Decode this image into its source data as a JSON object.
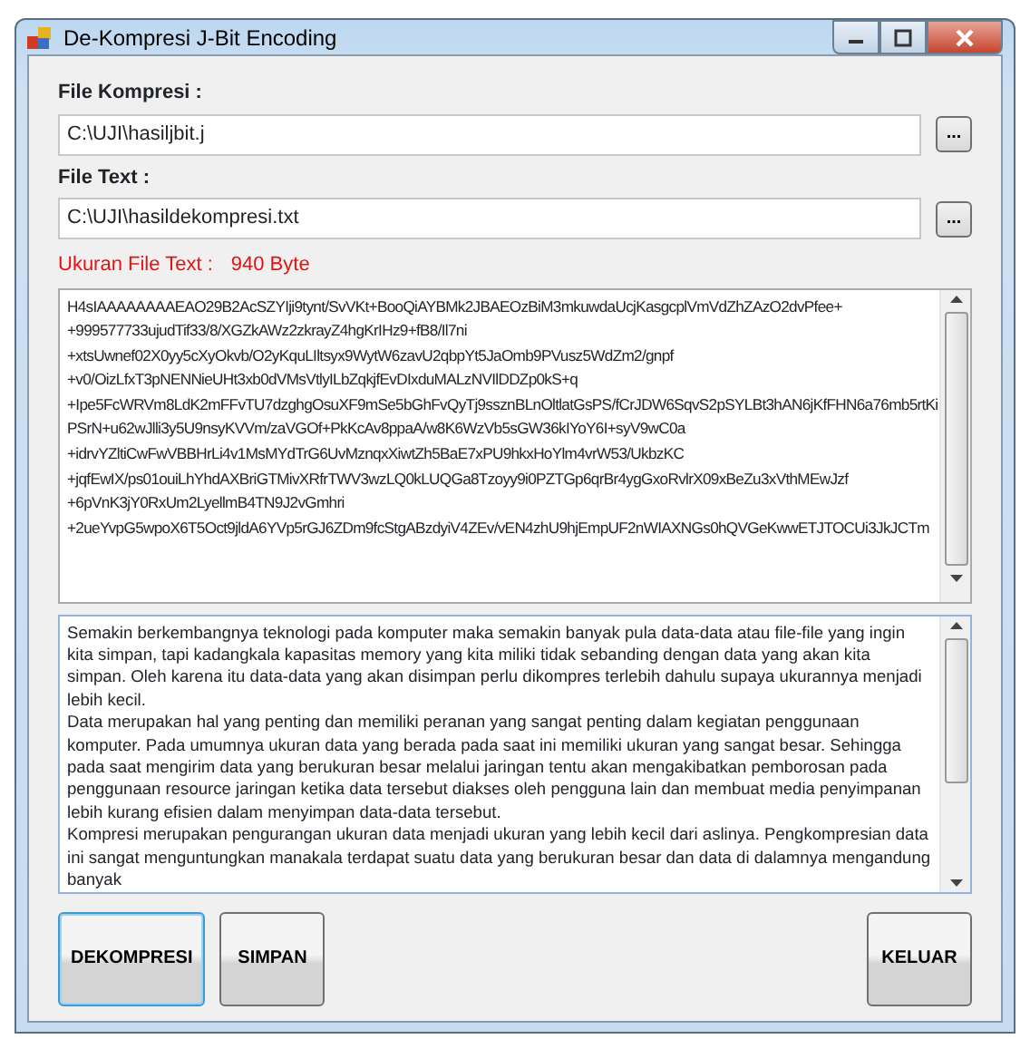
{
  "window": {
    "title": "De-Kompresi J-Bit Encoding"
  },
  "fields": [
    {
      "label": "File Kompresi :",
      "value": "C:\\UJI\\hasiljbit.j",
      "browse_button": "..."
    },
    {
      "label": "File Text :",
      "value": "C:\\UJI\\hasildekompresi.txt",
      "browse_button": "..."
    }
  ],
  "file_size": {
    "label": "Ukuran File Text :",
    "value": "940 Byte"
  },
  "encoded_text": {
    "lines": [
      "H4sIAAAAAAAAEAO29B2AcSZYIji9tynt/SvVKt+BooQiAYBMk2JBAEOzBiM3mkuwdaUcjKasgcplVmVdZhZAzO2dvPfee+",
      "+999577733ujudTif33/8/XGZkAWz2zkrayZ4hgKrIHz9+fB8/Il7ni",
      "+xtsUwnef02X0yy5cXyOkvb/O2yKquLIltsyx9WytW6zavU2qbpYt5JaOmb9PVusz5WdZm2/gnpf",
      "+v0/OizLfxT3pNENNieUHt3xb0dVMsVtlyILbZqkjfEvDIxduMALzNVIlDDZp0kS+q",
      "+Ipe5FcWRVm8LdK2mFFvTU7dzghgOsuXF9mSe5bGhFvQyTj9ssznBLnOltlatGsPS/fCrJDW6SqvS2pSYLBt3hAN6jKfFHN6a76mb5rtKi",
      "PSrN+u62wJlli3y5U9nsyKVVm/zaVGOf+PkKcAv8ppaA/w8K6WzVb5sGW36kIYoY6I+syV9wC0a",
      "+idrvYZltiCwFwVBBHrLi4v1MsMYdTrG6UvMznqxXiwtZh5BaE7xPU9hkxHoYlm4vrW53/UkbzKC",
      "+jqfEwIX/ps01ouiLhYhdAXBriGTMivXRfrTWV3wzLQ0kLUQGa8Tzoyy9i0PZTGp6qrBr4ygGxoRvlrX09xBeZu3xVthMEwJzf",
      "+6pVnK3jY0RxUm2LyellmB4TN9J2vGmhri",
      "+2ueYvpG5wpoX6T5Oct9jldA6YVp5rGJ6ZDm9fcStgABzdyiV4ZEv/vEN4zhU9hjEmpUF2nWIAXNGs0hQVGeKwwETJTOCUi3JkJCTm"
    ]
  },
  "decompressed_text": {
    "paragraphs": [
      "Semakin berkembangnya teknologi pada komputer maka semakin banyak pula data-data atau file-file yang ingin kita simpan, tapi kadangkala kapasitas memory yang kita miliki tidak sebanding dengan data yang akan kita simpan. Oleh karena itu data-data yang akan disimpan perlu dikompres terlebih dahulu supaya ukurannya menjadi lebih kecil.",
      "Data merupakan hal yang penting dan memiliki peranan yang sangat penting dalam kegiatan penggunaan komputer. Pada umumnya ukuran data yang berada pada saat ini memiliki ukuran yang sangat besar. Sehingga pada saat mengirim data yang berukuran besar melalui jaringan tentu akan mengakibatkan pemborosan pada penggunaan resource jaringan ketika data tersebut diakses oleh pengguna lain dan membuat media penyimpanan lebih kurang efisien dalam menyimpan data-data tersebut.",
      "Kompresi merupakan pengurangan ukuran data menjadi ukuran yang lebih kecil dari aslinya. Pengkompresian data ini sangat menguntungkan manakala terdapat suatu data yang berukuran besar dan data di dalamnya mengandung banyak"
    ]
  },
  "buttons_left": [
    {
      "label": "DEKOMPRESI",
      "focused": true
    },
    {
      "label": "SIMPAN",
      "focused": false
    }
  ],
  "buttons_right": [
    {
      "label": "KELUAR",
      "focused": false
    }
  ]
}
